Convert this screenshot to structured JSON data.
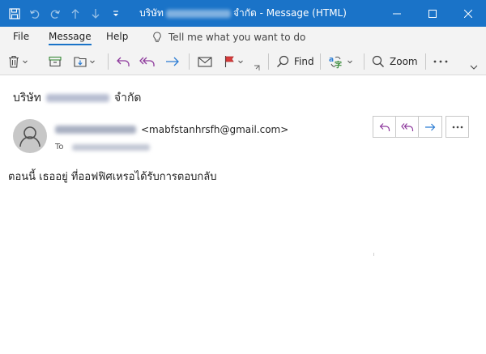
{
  "window": {
    "title_prefix": "บริษัท",
    "title_suffix": "จำกัด - Message (HTML)"
  },
  "menu": {
    "tabs": [
      {
        "label": "File"
      },
      {
        "label": "Message"
      },
      {
        "label": "Help"
      }
    ],
    "tell_me": "Tell me what you want to do"
  },
  "ribbon": {
    "find_label": "Find",
    "zoom_label": "Zoom"
  },
  "message": {
    "subject_prefix": "บริษัท",
    "subject_suffix": "จำกัด",
    "sender_email": "<mabfstanhrsfh@gmail.com>",
    "to_label": "To",
    "body": "ตอนนี้ เธออยู่ ที่ออฟฟิศเหรอได้รับการตอบกลับ"
  },
  "colors": {
    "titlebar": "#1a73c8",
    "reply_purple": "#8e3a9d",
    "forward_blue": "#2b7cd3",
    "flag_red": "#d83b3b",
    "move_green": "#3a8a3a"
  }
}
